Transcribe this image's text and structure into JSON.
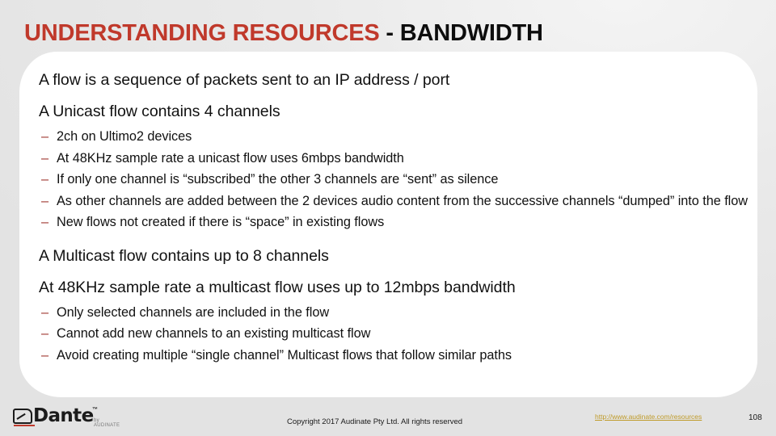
{
  "slide": {
    "title": {
      "accent": "UNDERSTANDING RESOURCES",
      "rest": " - BANDWIDTH",
      "accent_color": "#c0392b",
      "rest_color": "#0d0d0d"
    },
    "body": {
      "items": [
        {
          "level": 1,
          "text": "A flow is a sequence of packets sent to an IP address / port"
        },
        {
          "level": 1,
          "text": "A Unicast flow contains 4 channels"
        },
        {
          "level": 2,
          "text": "2ch on Ultimo2 devices"
        },
        {
          "level": 2,
          "text": "At 48KHz sample rate a unicast flow uses 6mbps bandwidth"
        },
        {
          "level": 2,
          "text": "If only one channel is “subscribed” the other 3 channels are “sent” as silence"
        },
        {
          "level": 2,
          "text": "As other channels are added between the 2 devices audio content from the successive channels “dumped” into the flow"
        },
        {
          "level": 2,
          "text": "New flows not created if there is “space” in existing flows"
        },
        {
          "level": 1,
          "text": "A Multicast flow contains up to 8 channels"
        },
        {
          "level": 1,
          "text": "At 48KHz sample rate a multicast flow uses up to 12mbps bandwidth"
        },
        {
          "level": 2,
          "text": "Only selected channels are included in the flow"
        },
        {
          "level": 2,
          "text": "Cannot add new channels to an existing multicast flow"
        },
        {
          "level": 2,
          "text": "Avoid creating multiple “single channel” Multicast flows that follow similar paths"
        }
      ],
      "bullet_dash": "–",
      "dash_color": "#a03a33"
    },
    "footer": {
      "logo_word": "Dante",
      "logo_tm": "™",
      "logo_sub": "by AUDINATE",
      "logo_accent_color": "#c0392b",
      "copyright": "Copyright 2017 Audinate Pty Ltd. All rights reserved",
      "link_text": "http://www.audinate.com/resources",
      "link_color": "#bf9b2a",
      "page_number": "108"
    },
    "background_color": "#e9e9e9",
    "panel_color": "#ffffff"
  }
}
